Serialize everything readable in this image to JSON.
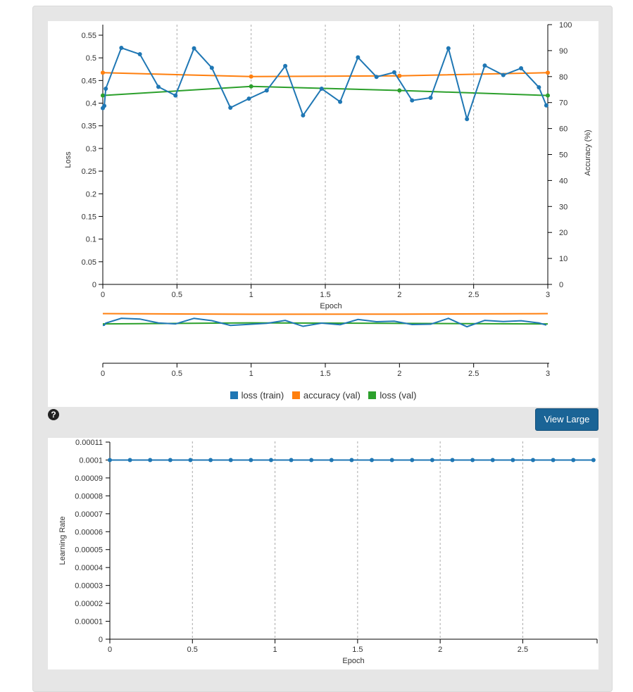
{
  "view_large_label": "View Large",
  "help_icon_glyph": "?",
  "chart_data": [
    {
      "type": "line",
      "xlabel": "Epoch",
      "ylabel": "Loss",
      "y2label": "Accuracy (%)",
      "xlim": [
        0,
        3
      ],
      "ylim": [
        0,
        0.55
      ],
      "y2lim": [
        0,
        100
      ],
      "x_ticks": [
        "0",
        "0.5",
        "1",
        "1.5",
        "2",
        "2.5",
        "3"
      ],
      "y_ticks": [
        "0",
        "0.05",
        "0.1",
        "0.15",
        "0.2",
        "0.25",
        "0.3",
        "0.35",
        "0.4",
        "0.45",
        "0.5",
        "0.55"
      ],
      "y2_ticks": [
        "0",
        "10",
        "20",
        "30",
        "40",
        "50",
        "60",
        "70",
        "80",
        "90",
        "100"
      ],
      "x_grid": "dashed vertical",
      "legend_position": "bottom-center",
      "series": [
        {
          "name": "loss (train)",
          "color": "#1f77b4",
          "axis": "left",
          "x": [
            0,
            0.01,
            0.02,
            0.125,
            0.25,
            0.375,
            0.49,
            0.615,
            0.735,
            0.86,
            0.985,
            1.105,
            1.23,
            1.35,
            1.475,
            1.6,
            1.72,
            1.845,
            1.965,
            2.085,
            2.21,
            2.33,
            2.455,
            2.575,
            2.7,
            2.82,
            2.94,
            2.99
          ],
          "values": [
            0.389,
            0.394,
            0.432,
            0.522,
            0.508,
            0.436,
            0.417,
            0.521,
            0.478,
            0.39,
            0.41,
            0.428,
            0.482,
            0.373,
            0.432,
            0.403,
            0.501,
            0.458,
            0.468,
            0.406,
            0.412,
            0.521,
            0.365,
            0.483,
            0.462,
            0.477,
            0.435,
            0.395
          ]
        },
        {
          "name": "accuracy (val)",
          "color": "#ff7f0e",
          "axis": "right",
          "x": [
            0,
            1,
            2,
            3
          ],
          "values": [
            81.5,
            80.0,
            80.3,
            81.5
          ]
        },
        {
          "name": "loss (val)",
          "color": "#2ca02c",
          "axis": "left",
          "x": [
            0,
            1,
            2,
            3
          ],
          "values": [
            0.417,
            0.437,
            0.428,
            0.417
          ]
        }
      ]
    },
    {
      "type": "line",
      "role": "overview",
      "xlim": [
        0,
        3
      ],
      "x_ticks": [
        "0",
        "0.5",
        "1",
        "1.5",
        "2",
        "2.5",
        "3"
      ]
    },
    {
      "type": "line",
      "xlabel": "Epoch",
      "ylabel": "Learning Rate",
      "xlim": [
        0,
        2.95
      ],
      "ylim": [
        0,
        0.00011
      ],
      "x_ticks": [
        "0",
        "0.5",
        "1",
        "1.5",
        "2",
        "2.5"
      ],
      "y_ticks": [
        "0",
        "0.00001",
        "0.00002",
        "0.00003",
        "0.00004",
        "0.00005",
        "0.00006",
        "0.00007",
        "0.00008",
        "0.00009",
        "0.0001",
        "0.00011"
      ],
      "x_grid": "dashed vertical",
      "series": [
        {
          "name": "",
          "color": "#1f77b4",
          "x": [
            0,
            0.122,
            0.244,
            0.366,
            0.488,
            0.61,
            0.732,
            0.854,
            0.976,
            1.098,
            1.22,
            1.342,
            1.464,
            1.586,
            1.708,
            1.83,
            1.952,
            2.074,
            2.196,
            2.318,
            2.44,
            2.562,
            2.684,
            2.806,
            2.928
          ],
          "values": [
            0.0001,
            0.0001,
            0.0001,
            0.0001,
            0.0001,
            0.0001,
            0.0001,
            0.0001,
            0.0001,
            0.0001,
            0.0001,
            0.0001,
            0.0001,
            0.0001,
            0.0001,
            0.0001,
            0.0001,
            0.0001,
            0.0001,
            0.0001,
            0.0001,
            0.0001,
            0.0001,
            0.0001,
            0.0001
          ]
        }
      ]
    }
  ]
}
